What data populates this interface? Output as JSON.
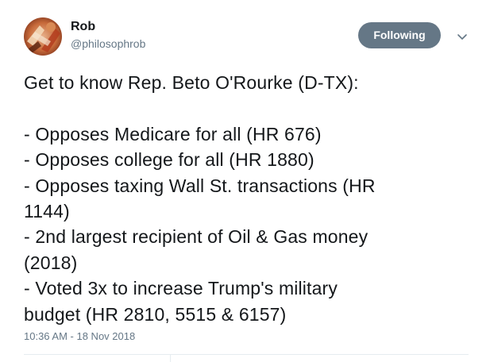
{
  "user": {
    "display_name": "Rob",
    "handle": "@philosophrob",
    "avatar_icon": "avatar-photo"
  },
  "actions": {
    "follow_label": "Following",
    "follow_color": "#657786",
    "more_icon": "chevron-down-icon"
  },
  "tweet": {
    "intro": "Get to know Rep. Beto O'Rourke (D-TX):",
    "lines": [
      "- Opposes Medicare for all (HR 676)",
      "- Opposes college for all (HR 1880)",
      "- Opposes taxing Wall St. transactions (HR",
      "1144)",
      "- 2nd largest recipient of Oil & Gas money",
      "(2018)",
      "- Voted 3x to increase Trump's military",
      "budget (HR 2810, 5515 & 6157)"
    ],
    "timestamp": "10:36 AM - 18 Nov 2018"
  }
}
